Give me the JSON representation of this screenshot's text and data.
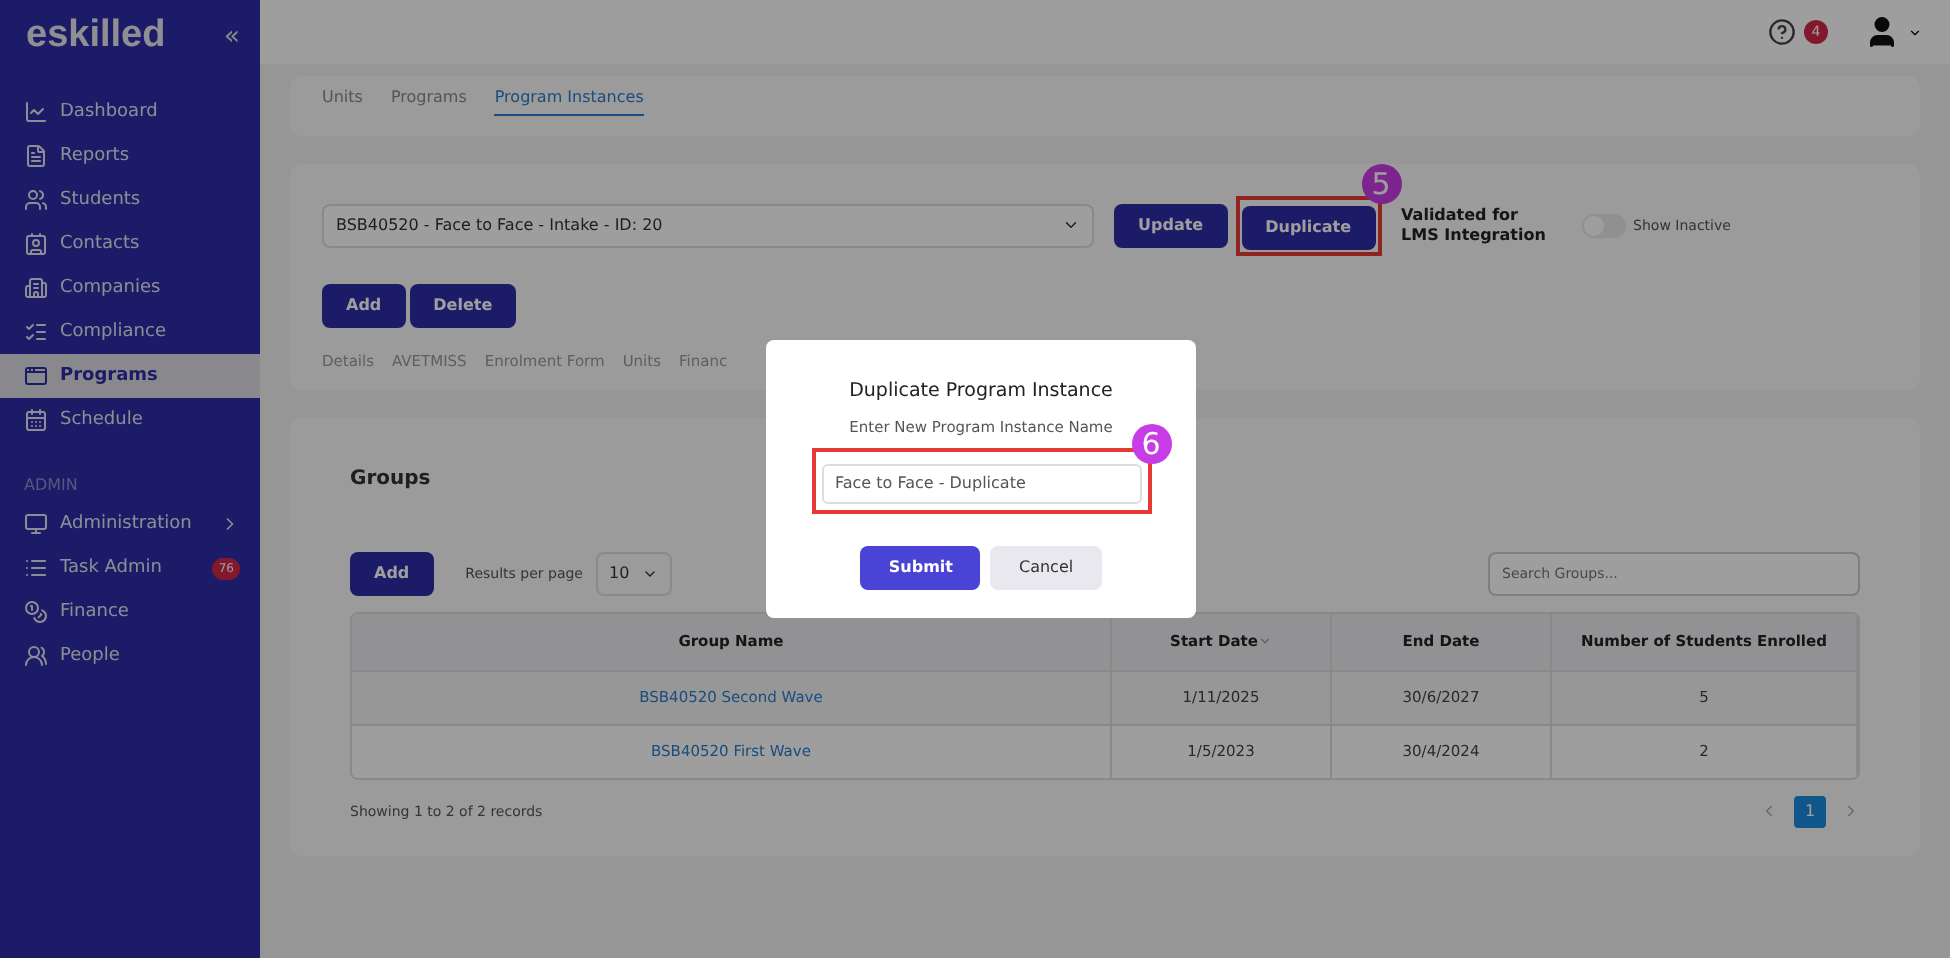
{
  "sidebar": {
    "logo": "eskilled",
    "collapse": "«",
    "items": [
      {
        "label": "Dashboard",
        "selected": false
      },
      {
        "label": "Reports",
        "selected": false
      },
      {
        "label": "Students",
        "selected": false
      },
      {
        "label": "Contacts",
        "selected": false
      },
      {
        "label": "Companies",
        "selected": false
      },
      {
        "label": "Compliance",
        "selected": false
      },
      {
        "label": "Programs",
        "selected": true
      },
      {
        "label": "Schedule",
        "selected": false
      }
    ],
    "section": "ADMIN",
    "admin_items": [
      {
        "label": "Administration",
        "expandable": true
      },
      {
        "label": "Task Admin",
        "badge": "76"
      },
      {
        "label": "Finance"
      },
      {
        "label": "People"
      }
    ]
  },
  "header": {
    "help_badge": "4"
  },
  "top_tabs": [
    {
      "label": "Units",
      "selected": false
    },
    {
      "label": "Programs",
      "selected": false
    },
    {
      "label": "Program Instances",
      "selected": true
    }
  ],
  "instance": {
    "select_value": "BSB40520 - Face to Face - Intake - ID: 20",
    "buttons": [
      "Update",
      "Duplicate"
    ],
    "validated": "Validated for LMS Integration",
    "show_inactive": {
      "label": "Show Inactive",
      "on": false
    },
    "actions": [
      "Add",
      "Delete"
    ],
    "sub_tabs": [
      "Details",
      "AVETMISS",
      "Enrolment Form",
      "Units",
      "Financ"
    ]
  },
  "groups": {
    "title": "Groups",
    "add": "Add",
    "results_label": "Results per page",
    "results_value": "10",
    "search_placeholder": "Search Groups...",
    "columns": [
      "Group Name",
      "Start Date",
      "End Date",
      "Number of Students Enrolled"
    ],
    "rows": [
      [
        "BSB40520 Second Wave",
        "1/11/2025",
        "30/6/2027",
        "5"
      ],
      [
        "BSB40520 First Wave",
        "1/5/2023",
        "30/4/2024",
        "2"
      ]
    ],
    "summary": "Showing 1 to 2 of 2 records",
    "page": "1"
  },
  "dialog": {
    "title": "Duplicate Program Instance",
    "label": "Enter New Program Instance Name",
    "value": "Face to Face - Duplicate",
    "submit": "Submit",
    "cancel": "Cancel"
  },
  "annotations": [
    "5",
    "6"
  ]
}
